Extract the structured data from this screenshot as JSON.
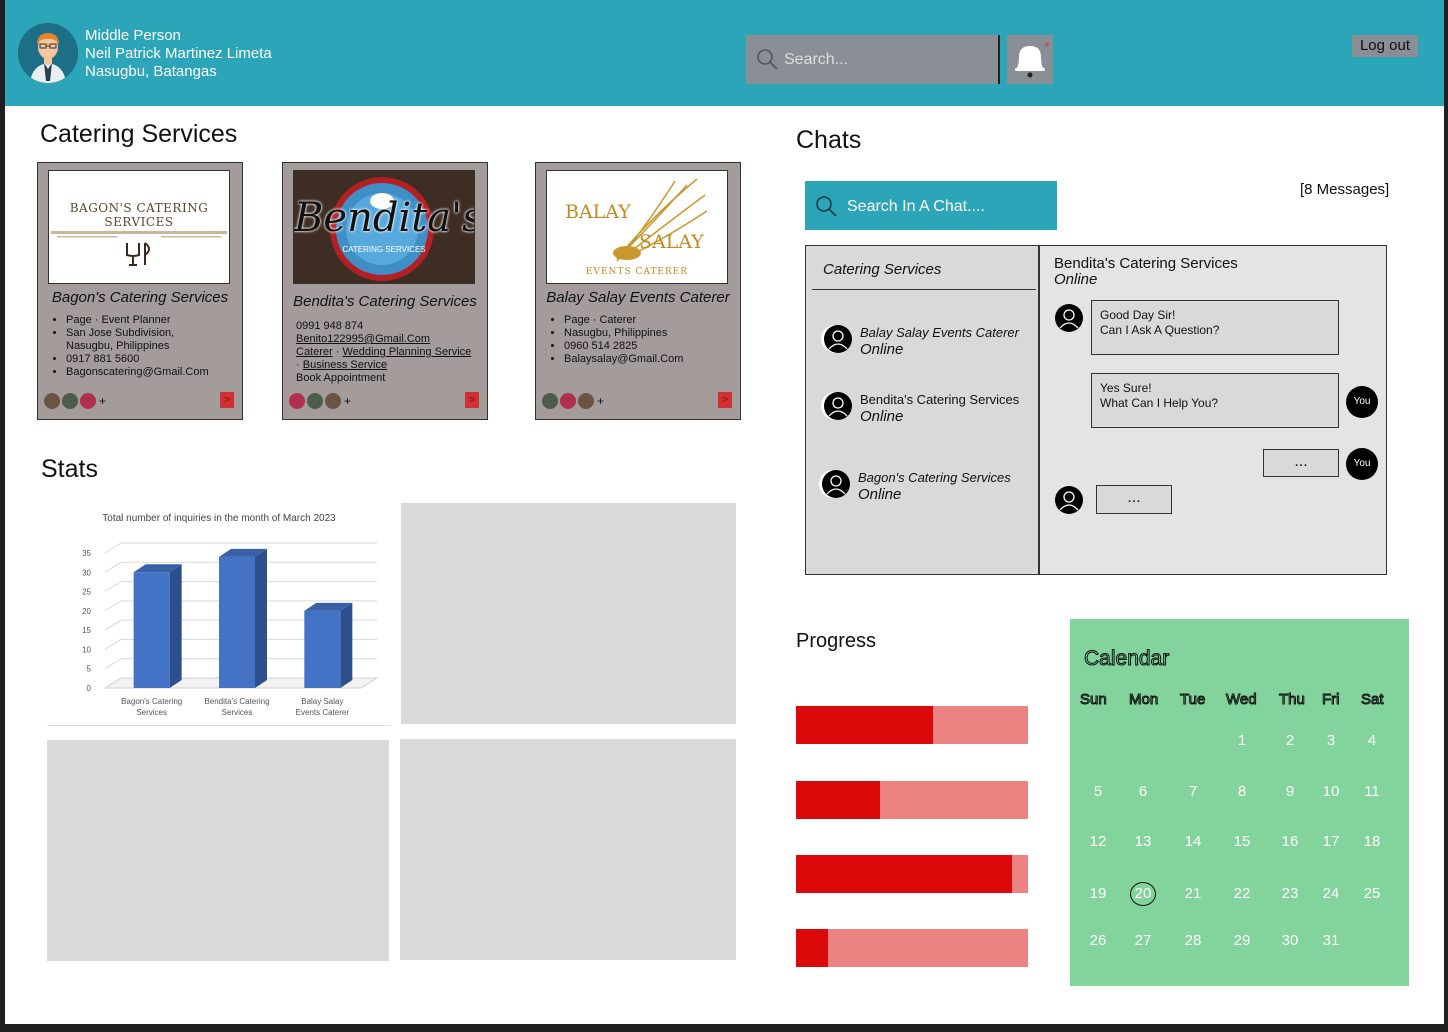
{
  "header": {
    "user_role": "Middle Person",
    "user_name": "Neil Patrick Martinez Limeta",
    "user_location": "Nasugbu, Batangas",
    "search_placeholder": "Search...",
    "logout_label": "Log out"
  },
  "catering": {
    "title": "Catering Services",
    "cards": [
      {
        "name": "Bagon's Catering Services",
        "logo_text": "BAGON'S CATERING SERVICES",
        "details": [
          "Page · Event Planner",
          "San Jose Subdivision,",
          "Nasugbu, Philippines",
          "0917 881 5600",
          "Bagonscatering@Gmail.Com"
        ],
        "more": "+",
        "open": ">"
      },
      {
        "name": "Bendita's Catering Services",
        "logo_text": "Bendita's",
        "logo_sub": "CATERING SERVICES",
        "phone": "0991 948 874",
        "email": "Benito122995@Gmail.Com",
        "tags": [
          "Caterer",
          " · ",
          "Wedding Planning Service",
          "· ",
          "Business Service"
        ],
        "cta": "Book Appointment",
        "more": "+",
        "open": ">"
      },
      {
        "name": "Balay Salay Events Caterer",
        "logo_text": "BALAY",
        "logo_text2": "SALAY",
        "logo_sub": "EVENTS CATERER",
        "details": [
          "Page · Caterer",
          "Nasugbu, Philippines",
          "0960 514 2825",
          "Balaysalay@Gmail.Com"
        ],
        "more": "+",
        "open": ">"
      }
    ]
  },
  "stats": {
    "title": "Stats"
  },
  "chart_data": {
    "type": "bar",
    "title": "Total number of inquiries in the month of March 2023",
    "categories": [
      "Bagon's Catering Services",
      "Bendita's Catering Services",
      "Balay Salay Events Caterer"
    ],
    "values": [
      30,
      34,
      20
    ],
    "yticks": [
      0,
      5,
      10,
      15,
      20,
      25,
      30,
      35
    ],
    "ylim": [
      0,
      35
    ],
    "grid": true,
    "color": "#4472c4"
  },
  "chats": {
    "title": "Chats",
    "search_label": "Search In A Chat....",
    "message_count": "[8 Messages]",
    "list_title": "Catering Services",
    "contacts": [
      {
        "name": "Balay Salay Events Caterer",
        "status": "Online"
      },
      {
        "name": "Bendita's Catering Services",
        "status": "Online"
      },
      {
        "name": "Bagon's Catering Services",
        "status": "Online"
      }
    ],
    "active_name": "Bendita's Catering Services",
    "active_status": "Online",
    "messages": [
      {
        "line1": "Good Day Sir!",
        "line2": "Can I Ask A Question?"
      },
      {
        "line1": "Yes Sure!",
        "line2": "What Can I Help You?"
      },
      {
        "line1": "..."
      },
      {
        "line1": "..."
      }
    ],
    "you_label": "You"
  },
  "progress": {
    "title": "Progress",
    "values": [
      0.59,
      0.36,
      0.93,
      0.14
    ],
    "colors": {
      "fill": "#db0909",
      "track": "#ec8383"
    }
  },
  "calendar": {
    "title": "Calendar",
    "weekdays": [
      "Sun",
      "Mon",
      "Tue",
      "Wed",
      "Thu",
      "Fri",
      "Sat"
    ],
    "days": [
      "1",
      "2",
      "3",
      "4",
      "5",
      "6",
      "7",
      "8",
      "9",
      "10",
      "11",
      "12",
      "13",
      "14",
      "15",
      "16",
      "17",
      "18",
      "19",
      "20",
      "21",
      "22",
      "23",
      "24",
      "25",
      "26",
      "27",
      "28",
      "29",
      "30",
      "31"
    ],
    "today": "20"
  }
}
